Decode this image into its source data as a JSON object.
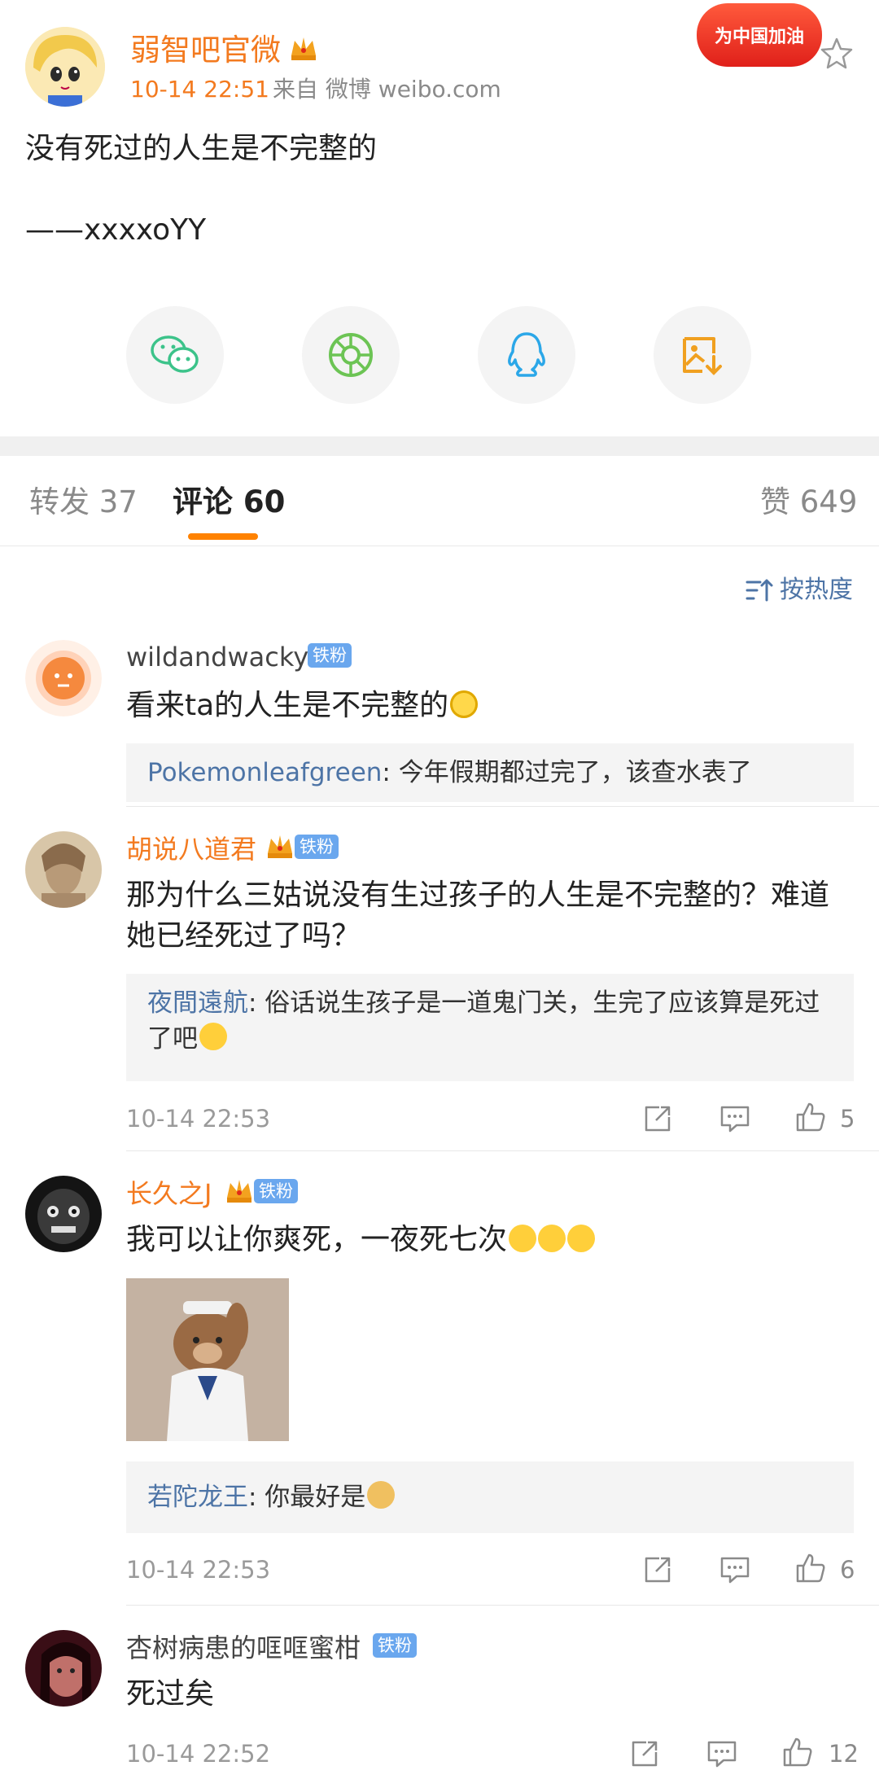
{
  "post": {
    "author": "弱智吧官微",
    "time": "10-14 22:51",
    "source": "来自 微博 weibo.com",
    "campaign_badge": "为中国加油",
    "text": "没有死过的人生是不完整的",
    "signature": "——xxxxoYY"
  },
  "share": {
    "icons": [
      "wechat-icon",
      "moments-icon",
      "qq-icon",
      "save-image-icon"
    ]
  },
  "tabs": {
    "repost": "转发 37",
    "comments": "评论 60",
    "likes": "赞 649"
  },
  "sort_label": "按热度",
  "fan_badge": "铁粉",
  "comments": [
    {
      "name": "wildandwacky",
      "text": "看来ta的人生是不完整的",
      "reply_user": "Pokemonleafgreen",
      "reply_text": ": 今年假期都过完了，该查水表了"
    },
    {
      "name": "胡说八道君",
      "text": "那为什么三姑说没有生过孩子的人生是不完整的？难道她已经死过了吗？",
      "reply_user": "夜間遠航",
      "reply_text": ": 俗话说生孩子是一道鬼门关，生完了应该算是死过了吧",
      "time": "10-14 22:53",
      "likes": "5"
    },
    {
      "name": "长久之J",
      "text": "我可以让你爽死，一夜死七次",
      "reply_user": "若陀龙王",
      "reply_text": ": 你最好是",
      "time": "10-14 22:53",
      "likes": "6"
    },
    {
      "name": "杏树病患的哐哐蜜柑",
      "text": "死过矣",
      "time": "10-14 22:52",
      "likes": "12"
    }
  ],
  "colors": {
    "accent": "#f37a1f",
    "link": "#4d74a6",
    "tab_indicator": "#ff8200",
    "fan_badge": "#6aa7ee"
  }
}
